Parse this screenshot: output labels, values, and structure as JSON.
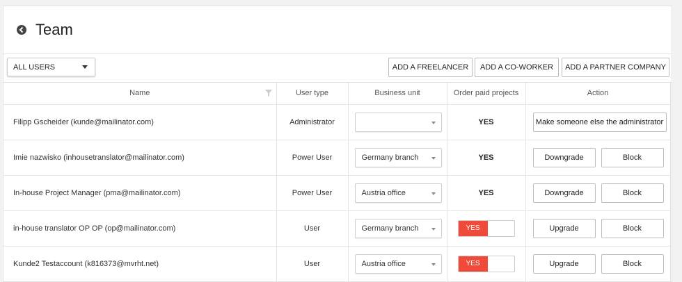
{
  "header": {
    "title": "Team"
  },
  "toolbar": {
    "filter_value": "ALL USERS",
    "add_freelancer": "ADD A FREELANCER",
    "add_coworker": "ADD A CO-WORKER",
    "add_partner": "ADD A PARTNER COMPANY"
  },
  "table": {
    "columns": [
      "Name",
      "User type",
      "Business unit",
      "Order paid projects",
      "Action"
    ],
    "rows": [
      {
        "name": "Filipp Gscheider (kunde@mailinator.com)",
        "type": "Administrator",
        "unit": "",
        "paid": "YES",
        "action1": "Make someone else the administrator"
      },
      {
        "name": "Imie nazwisko (inhousetranslator@mailinator.com)",
        "type": "Power User",
        "unit": "Germany branch",
        "paid": "YES",
        "action1": "Downgrade",
        "action2": "Block"
      },
      {
        "name": "In-house Project Manager (pma@mailinator.com)",
        "type": "Power User",
        "unit": "Austria office",
        "paid": "YES",
        "action1": "Downgrade",
        "action2": "Block"
      },
      {
        "name": "in-house translator OP OP (op@mailinator.com)",
        "type": "User",
        "unit": "Germany branch",
        "paid": "YES",
        "action1": "Upgrade",
        "action2": "Block"
      },
      {
        "name": "Kunde2 Testaccount (k816373@mvrht.net)",
        "type": "User",
        "unit": "Austria office",
        "paid": "YES",
        "action1": "Upgrade",
        "action2": "Block"
      }
    ]
  },
  "colors": {
    "toggle_on": "#f04a3b"
  },
  "icons": {
    "back": "back-arrow-circle-icon",
    "filter": "funnel-icon"
  }
}
